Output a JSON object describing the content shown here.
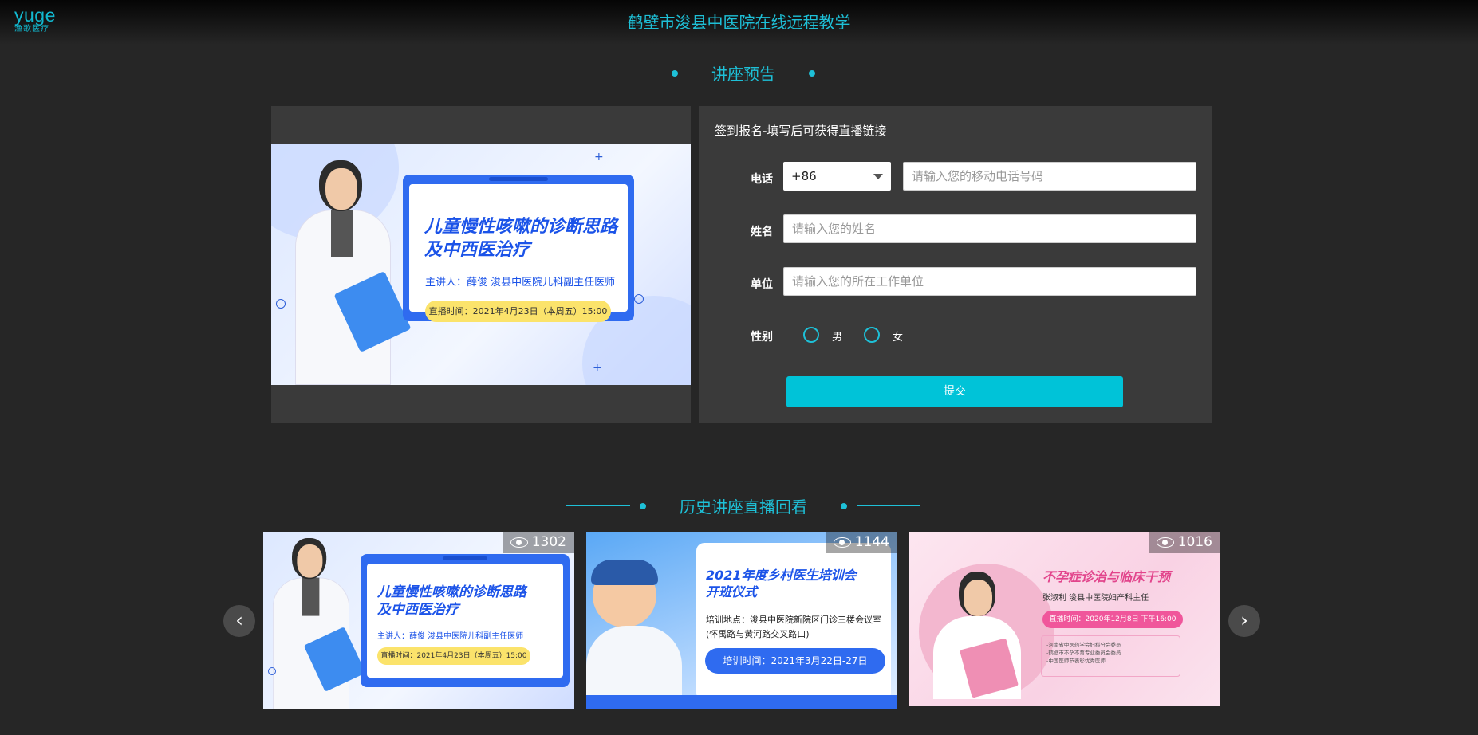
{
  "logo": {
    "text": "yuge",
    "subtitle": "渔歌医疗"
  },
  "header": {
    "title": "鹤壁市浚县中医院在线远程教学"
  },
  "preview_section": {
    "title": "讲座预告"
  },
  "history_section": {
    "title": "历史讲座直播回看"
  },
  "poster": {
    "title_line1": "儿童慢性咳嗽的诊断思路",
    "title_line2": "及中西医治疗",
    "speaker": "主讲人：薛俊  浚县中医院儿科副主任医师",
    "time": "直播时间：2021年4月23日（本周五）15:00"
  },
  "form": {
    "title": "签到报名-填写后可获得直播链接",
    "phone_label": "电话",
    "country_code": "+86",
    "phone_placeholder": "请输入您的移动电话号码",
    "name_label": "姓名",
    "name_placeholder": "请输入您的姓名",
    "unit_label": "单位",
    "unit_placeholder": "请输入您的所在工作单位",
    "gender_label": "性别",
    "male": "男",
    "female": "女",
    "submit": "提交"
  },
  "history_cards": [
    {
      "views": "1302",
      "title_line1": "儿童慢性咳嗽的诊断思路",
      "title_line2": "及中西医治疗",
      "speaker": "主讲人：薛俊  浚县中医院儿科副主任医师",
      "time": "直播时间：2021年4月23日（本周五）15:00"
    },
    {
      "views": "1144",
      "title_line1": "2021年度乡村医生培训会",
      "title_line2": "开班仪式",
      "place": "培训地点：浚县中医院新院区门诊三楼会议室(怀禹路与黄河路交叉路口)",
      "time": "培训时间：2021年3月22日-27日"
    },
    {
      "views": "1016",
      "title": "不孕症诊治与临床干预",
      "speaker": "张淑利 浚县中医院妇产科主任",
      "time": "直播时间：2020年12月8日 下午16:00",
      "notes": [
        "-河南省中医药学会妇科分会委员",
        "-鹤壁市不孕不育专业委员会委员",
        "-中国医师节表彰优秀医师"
      ]
    }
  ],
  "colors": {
    "accent": "#1ec0d7",
    "button": "#00c3d8",
    "panel": "#3a3a3a",
    "background": "#262626"
  }
}
